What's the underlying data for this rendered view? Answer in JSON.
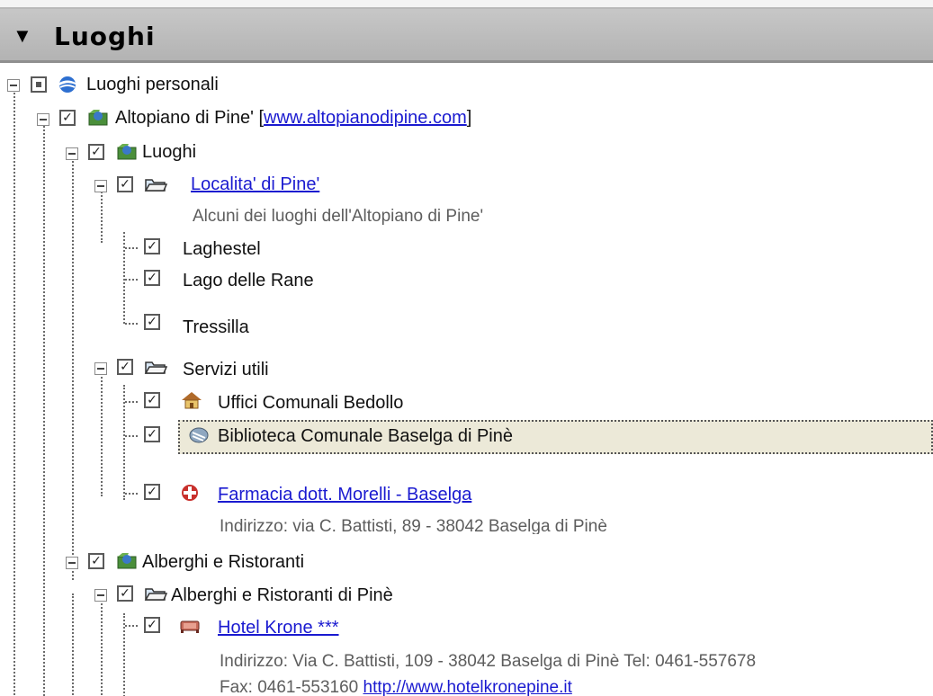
{
  "panel": {
    "title": "Luoghi"
  },
  "tree": {
    "root": {
      "label": "Luoghi personali"
    },
    "altopiano": {
      "label": "Altopiano di Pine' [",
      "url": "www.altopianodipine.com",
      "suffix": "]"
    },
    "luoghi": {
      "label": "Luoghi"
    },
    "localita": {
      "label": "Localita'  di Pine'",
      "description": "Alcuni dei luoghi dell'Altopiano di Pine'"
    },
    "places": [
      {
        "label": "Laghestel"
      },
      {
        "label": "Lago delle Rane"
      },
      {
        "label": "Tressilla"
      }
    ],
    "servizi": {
      "label": "Servizi utili"
    },
    "uffici": {
      "label": "Uffici Comunali Bedollo"
    },
    "biblioteca": {
      "label": "Biblioteca Comunale Baselga di Pinè"
    },
    "farmacia": {
      "label": "Farmacia dott. Morelli - Baselga",
      "description": "Indirizzo: via C. Battisti, 89 - 38042 Baselga di Pinè"
    },
    "alberghi": {
      "label": "Alberghi e Ristoranti"
    },
    "alberghi_pine": {
      "label": "Alberghi e Ristoranti di Pinè"
    },
    "hotel": {
      "label": "Hotel Krone ***",
      "description_1": "Indirizzo: Via C. Battisti, 109 - 38042 Baselga di Pinè Tel: 0461-557678",
      "description_2_prefix": "Fax: 0461-553160 ",
      "description_2_link": "http://www.hotelkronepine.it"
    }
  }
}
